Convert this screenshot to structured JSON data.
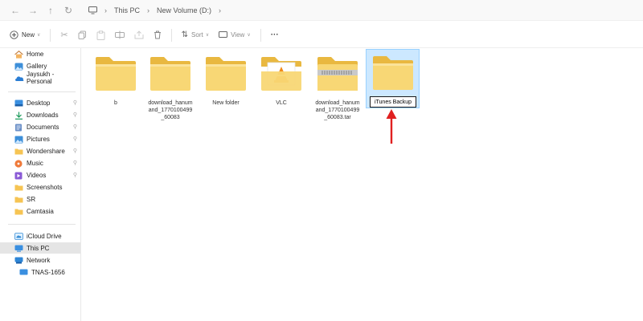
{
  "address_bar": {
    "crumbs": [
      "This PC",
      "New Volume (D:)"
    ]
  },
  "command_bar": {
    "new_label": "New",
    "sort_label": "Sort",
    "view_label": "View",
    "more_label": "···"
  },
  "sidebar": {
    "items": [
      {
        "label": "Home",
        "icon": "home-icon"
      },
      {
        "label": "Gallery",
        "icon": "gallery-icon"
      },
      {
        "label": "Jaysukh - Personal",
        "icon": "onedrive-icon"
      },
      {
        "label": "Desktop",
        "icon": "desktop-icon",
        "pinned": true
      },
      {
        "label": "Downloads",
        "icon": "downloads-icon",
        "pinned": true
      },
      {
        "label": "Documents",
        "icon": "documents-icon",
        "pinned": true
      },
      {
        "label": "Pictures",
        "icon": "pictures-icon",
        "pinned": true
      },
      {
        "label": "Wondershare",
        "icon": "folder-icon",
        "pinned": true
      },
      {
        "label": "Music",
        "icon": "music-icon",
        "pinned": true
      },
      {
        "label": "Videos",
        "icon": "videos-icon",
        "pinned": true
      },
      {
        "label": "Screenshots",
        "icon": "folder-icon"
      },
      {
        "label": "SR",
        "icon": "folder-icon"
      },
      {
        "label": "Camtasia",
        "icon": "folder-icon"
      },
      {
        "label": "iCloud Drive",
        "icon": "icloud-icon"
      },
      {
        "label": "This PC",
        "icon": "this-pc-icon",
        "selected": true
      },
      {
        "label": "Network",
        "icon": "network-icon"
      },
      {
        "label": "TNAS-1656",
        "icon": "nas-icon"
      }
    ]
  },
  "files": [
    {
      "name": "b",
      "type": "folder"
    },
    {
      "name": "download_hanumand_1770100499_60083",
      "type": "folder"
    },
    {
      "name": "New folder",
      "type": "folder"
    },
    {
      "name": "VLC",
      "type": "vlc-folder"
    },
    {
      "name": "download_hanumand_1770100499_60083.tar",
      "type": "zip-folder"
    },
    {
      "name": "iTunes Backup",
      "type": "folder",
      "renaming": true
    }
  ],
  "colors": {
    "accent": "#0067c0",
    "selection_bg": "#cce8ff",
    "folder": "#f8d775",
    "annotation_arrow": "#e02020"
  }
}
